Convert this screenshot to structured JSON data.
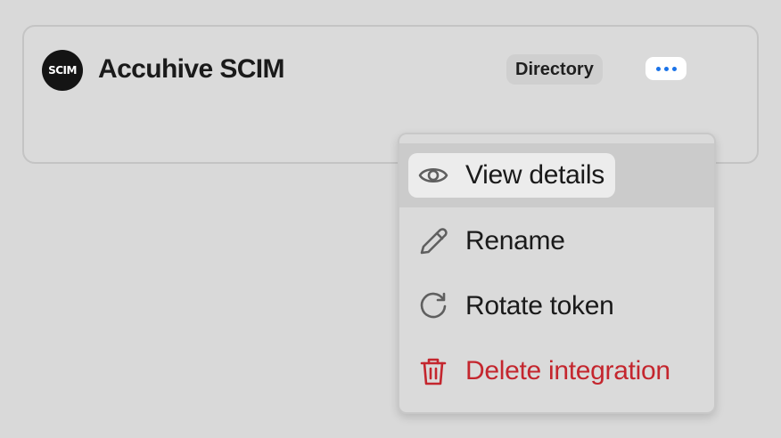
{
  "integration": {
    "logo_text": "SCIM",
    "name": "Accuhive SCIM",
    "badge": "Directory",
    "more_label": "More options"
  },
  "menu": {
    "items": [
      {
        "label": "View details",
        "icon": "eye-icon",
        "state": "hovered"
      },
      {
        "label": "Rename",
        "icon": "pencil-icon"
      },
      {
        "label": "Rotate token",
        "icon": "rotate-icon"
      },
      {
        "label": "Delete integration",
        "icon": "trash-icon",
        "style": "danger"
      }
    ]
  },
  "colors": {
    "accent": "#1a73e8",
    "danger": "#c4262e",
    "background": "#d9d9d9"
  }
}
